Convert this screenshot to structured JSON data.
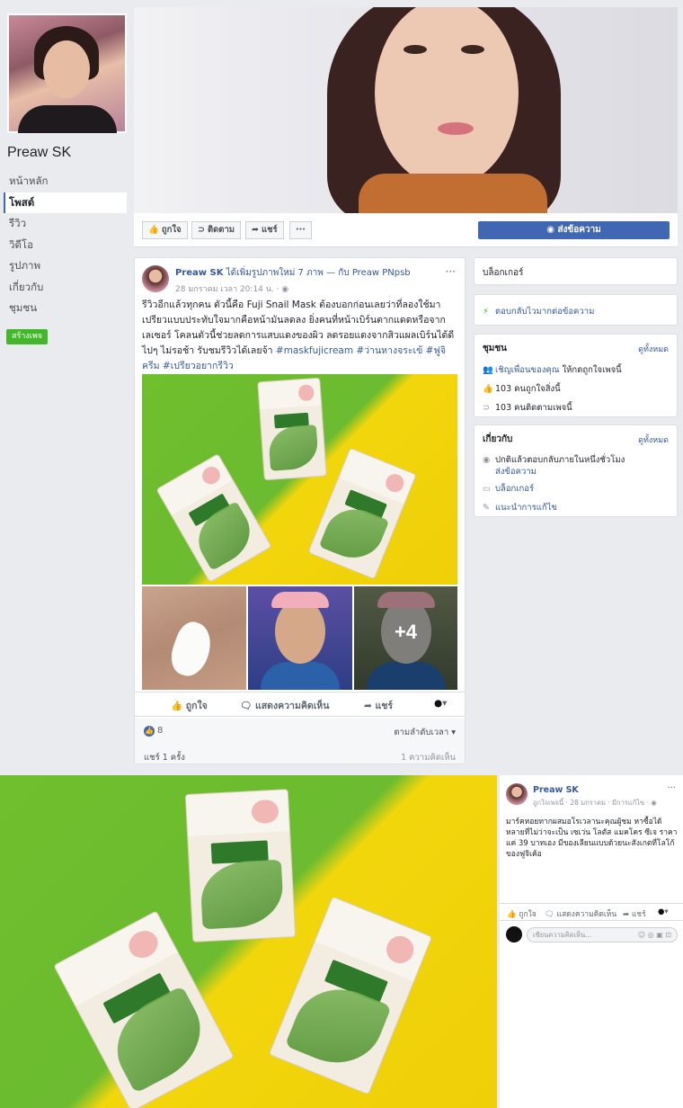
{
  "page": {
    "name": "Preaw SK"
  },
  "sidebar": {
    "items": [
      {
        "label": "หน้าหลัก"
      },
      {
        "label": "โพสต์"
      },
      {
        "label": "รีวิว"
      },
      {
        "label": "วิดีโอ"
      },
      {
        "label": "รูปภาพ"
      },
      {
        "label": "เกี่ยวกับ"
      },
      {
        "label": "ชุมชน"
      }
    ],
    "create_page": "สร้างเพจ"
  },
  "action_bar": {
    "like": "ถูกใจ",
    "follow": "ติดตาม",
    "share": "แชร์",
    "more": "···",
    "send_message": "ส่งข้อความ"
  },
  "post": {
    "author": "Preaw SK",
    "action_text": "ได้เพิ่มรูปภาพใหม่ 7 ภาพ — กับ Preaw PNpsb",
    "meta": "28 มกราคม เวลา 20:14 น. · ◉",
    "text": "รีวิวอีกแล้วทุกคน ตัวนี้คือ Fuji Snail Mask ต้องบอกก่อนเลยว่าที่ลองใช้มาเปรียวแบบประทับใจมากคือหน้ามันลดลง ยิ่งคนที่หน้าเบิร์นตากแดดหรือจากเลเซอร์ โคลนตัวนี้ช่วยลดการแสบแดงของผิว ลดรอยแดงจากสิวแผลเบิร์นได้ดี ไปๆ ไม่รอช้า รับชมรีวิวได้เลยจ้า ",
    "hashtags": "#maskfujicream #ว่านหางจระเข้ #ฟูจิครีม #เปรียวอยากรีวิว",
    "more_photos": "+4",
    "actions": {
      "like": "ถูกใจ",
      "comment": "แสดงความคิดเห็น",
      "share": "แชร์"
    },
    "like_count": "8",
    "sort": "ตามลำดับเวลา ▾",
    "shares": "แชร์ 1 ครั้ง",
    "comments": "1 ความคิดเห็น"
  },
  "right": {
    "blogger": "บล็อกเกอร์",
    "response": "ตอบกลับไวมากต่อข้อความ",
    "community": {
      "title": "ชุมชน",
      "see_all": "ดูทั้งหมด",
      "invite_link": "เชิญเพื่อนของคุณ",
      "invite_rest": " ให้กดถูกใจเพจนี้",
      "likes": "103 คนถูกใจสิ่งนี้",
      "follows": "103 คนติดตามเพจนี้"
    },
    "about": {
      "title": "เกี่ยวกับ",
      "see_all": "ดูทั้งหมด",
      "reply_time": "ปกติแล้วตอบกลับภายในหนึ่งชั่วโมง",
      "send_message": "ส่งข้อความ",
      "category": "บล็อกเกอร์",
      "suggest_edit": "แนะนำการแก้ไข"
    }
  },
  "lightbox": {
    "author": "Preaw SK",
    "meta": "ถูกใจเพจนี้ · 28 มกราคม · มีการแก้ไข · ◉",
    "more": "···",
    "text": "มาร์คหอยทากผสมอโรเวลานะคุณผู้ชม หาซื้อได้หลายที่ไม่ว่าจะเป็น เซเว่น โลตัส แมคโคร ซีเจ ราคาแค่ 39 บาทเอง มีของเลียนแบบด้วยนะสังเกตที่โลโก้ของฟูจิเค้อ",
    "actions": {
      "like": "ถูกใจ",
      "comment": "แสดงความคิดเห็น",
      "share": "แชร์"
    },
    "comment_placeholder": "เขียนความคิดเห็น..."
  }
}
